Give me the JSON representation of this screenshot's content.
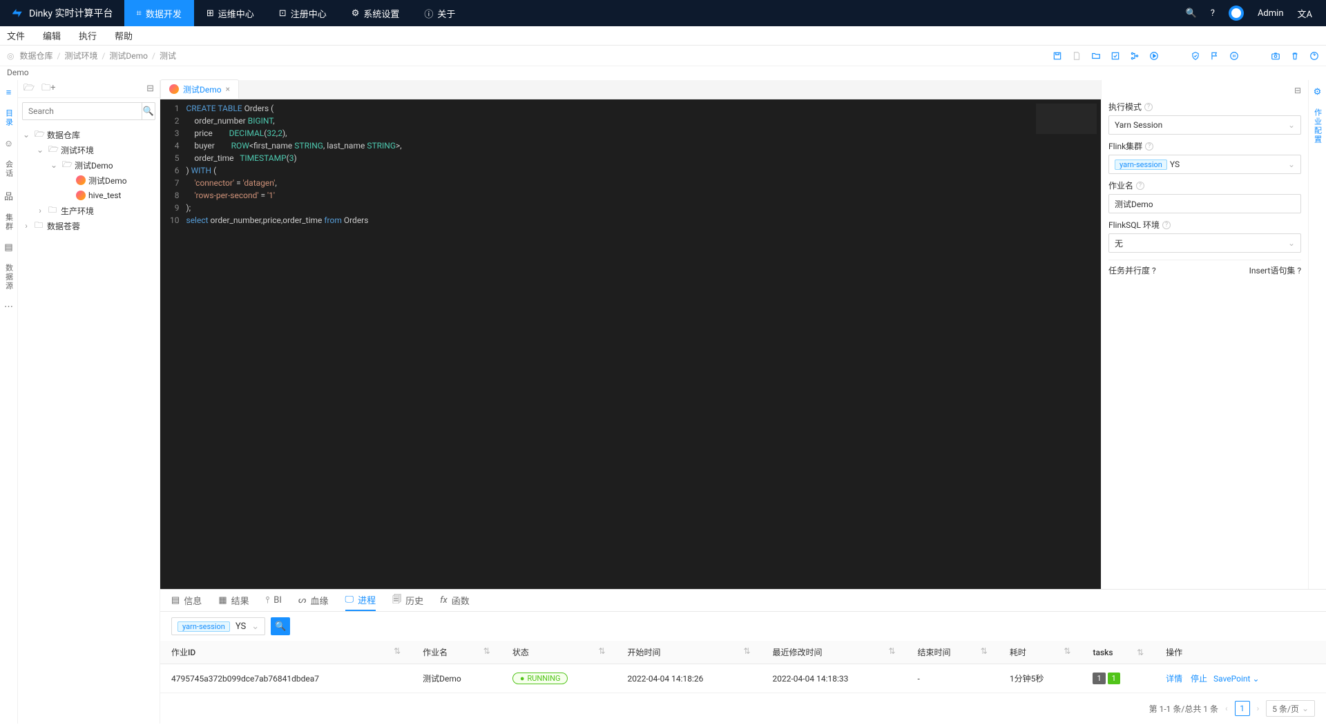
{
  "brand": "Dinky 实时计算平台",
  "topnav": [
    {
      "label": "数据开发",
      "active": true
    },
    {
      "label": "运维中心"
    },
    {
      "label": "注册中心"
    },
    {
      "label": "系统设置"
    },
    {
      "label": "关于"
    }
  ],
  "user": "Admin",
  "submenu": [
    "文件",
    "编辑",
    "执行",
    "帮助"
  ],
  "breadcrumb": [
    "数据仓库",
    "测试环境",
    "测试Demo",
    "测试"
  ],
  "breadcrumb_sub": "Demo",
  "left_rail": [
    "目录",
    "会话",
    "集群",
    "数据源"
  ],
  "tree_search_placeholder": "Search",
  "tree": {
    "root": "数据仓库",
    "env1": "测试环境",
    "demo": "测试Demo",
    "leaf1": "测试Demo",
    "leaf2": "hive_test",
    "env2": "生产环境",
    "root2": "数据苍蓉"
  },
  "tab": {
    "label": "测试Demo"
  },
  "code": {
    "l1a": "CREATE",
    "l1b": "TABLE",
    "l1c": " Orders (",
    "l2a": "    order_number ",
    "l2b": "BIGINT",
    "l2c": ",",
    "l3a": "    price        ",
    "l3b": "DECIMAL",
    "l3c": "(",
    "l3d": "32",
    "l3e": ",",
    "l3f": "2",
    "l3g": "),",
    "l4a": "    buyer        ",
    "l4b": "ROW",
    "l4c": "<first_name ",
    "l4d": "STRING",
    "l4e": ", last_name ",
    "l4f": "STRING",
    "l4g": ">,",
    "l5a": "    order_time   ",
    "l5b": "TIMESTAMP",
    "l5c": "(",
    "l5d": "3",
    "l5e": ")",
    "l6a": ") ",
    "l6b": "WITH",
    "l6c": " (",
    "l7a": "    ",
    "l7b": "'connector'",
    "l7c": " = ",
    "l7d": "'datagen'",
    "l7e": ",",
    "l8a": "    ",
    "l8b": "'rows-per-second'",
    "l8c": " = ",
    "l8d": "'1'",
    "l9": ");",
    "l10a": "select",
    "l10b": " order_number,price,order_time ",
    "l10c": "from",
    "l10d": " Orders"
  },
  "right": {
    "mode_label": "执行模式",
    "mode_value": "Yarn Session",
    "cluster_label": "Flink集群",
    "cluster_tag": "yarn-session",
    "cluster_value": "YS",
    "job_label": "作业名",
    "job_value": "测试Demo",
    "env_label": "FlinkSQL 环境",
    "env_value": "无",
    "parallel_label": "任务并行度",
    "insert_label": "Insert语句集"
  },
  "right_rail": [
    "作业配置"
  ],
  "bottom_tabs": [
    "信息",
    "结果",
    "BI",
    "血缘",
    "进程",
    "历史",
    "函数"
  ],
  "filter": {
    "tag": "yarn-session",
    "value": "YS"
  },
  "cols": [
    "作业ID",
    "作业名",
    "状态",
    "开始时间",
    "最近修改时间",
    "结束时间",
    "耗时",
    "tasks",
    "操作"
  ],
  "row": {
    "id": "4795745a372b099dce7ab76841dbdea7",
    "name": "测试Demo",
    "status": "RUNNING",
    "start": "2022-04-04 14:18:26",
    "modified": "2022-04-04 14:18:33",
    "end": "-",
    "duration": "1分钟5秒",
    "task_a": "1",
    "task_b": "1",
    "op_detail": "详情",
    "op_stop": "停止",
    "op_save": "SavePoint"
  },
  "pager": {
    "text": "第 1-1 条/总共 1 条",
    "page": "1",
    "size": "5 条/页"
  }
}
